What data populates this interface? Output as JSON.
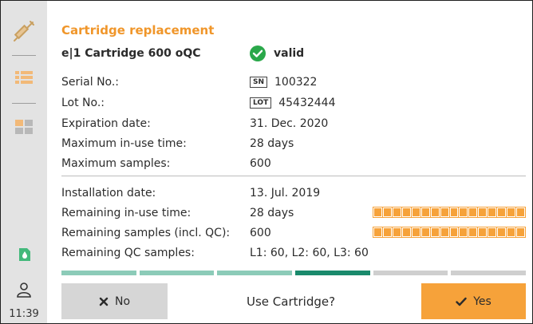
{
  "sidebar": {
    "time": "11:39",
    "icons": [
      "syringe-icon",
      "list-icon",
      "grid-icon",
      "reagent-icon",
      "user-icon"
    ]
  },
  "header": {
    "title": "Cartridge replacement",
    "cartridge_name": "e|1 Cartridge 600 oQC",
    "status_text": "valid"
  },
  "details": [
    {
      "label": "Serial No.:",
      "tag": "SN",
      "value": "100322"
    },
    {
      "label": "Lot No.:",
      "tag": "LOT",
      "value": "45432444"
    },
    {
      "label": "Expiration date:",
      "value": "31. Dec. 2020"
    },
    {
      "label": "Maximum in-use time:",
      "value": "28 days"
    },
    {
      "label": "Maximum samples:",
      "value": "600"
    }
  ],
  "usage": [
    {
      "label": "Installation date:",
      "value": "13. Jul. 2019"
    },
    {
      "label": "Remaining in-use time:",
      "value": "28 days",
      "fill_fraction": 1.0
    },
    {
      "label": "Remaining samples (incl. QC):",
      "value": "600",
      "fill_fraction": 1.0
    },
    {
      "label": "Remaining QC samples:",
      "value": "L1: 60, L2: 60, L3: 60"
    }
  ],
  "progress_steps": [
    {
      "state": "done",
      "color": "#8ccbb8"
    },
    {
      "state": "done",
      "color": "#8ccbb8"
    },
    {
      "state": "done",
      "color": "#8ccbb8"
    },
    {
      "state": "current",
      "color": "#1a8a6c"
    },
    {
      "state": "todo",
      "color": "#cfcfcf"
    },
    {
      "state": "todo",
      "color": "#cfcfcf"
    }
  ],
  "footer": {
    "no_label": "No",
    "prompt": "Use Cartridge?",
    "yes_label": "Yes"
  },
  "colors": {
    "accent": "#f0962a",
    "valid_green": "#2aa84a",
    "bar_orange": "#f6a23a"
  }
}
